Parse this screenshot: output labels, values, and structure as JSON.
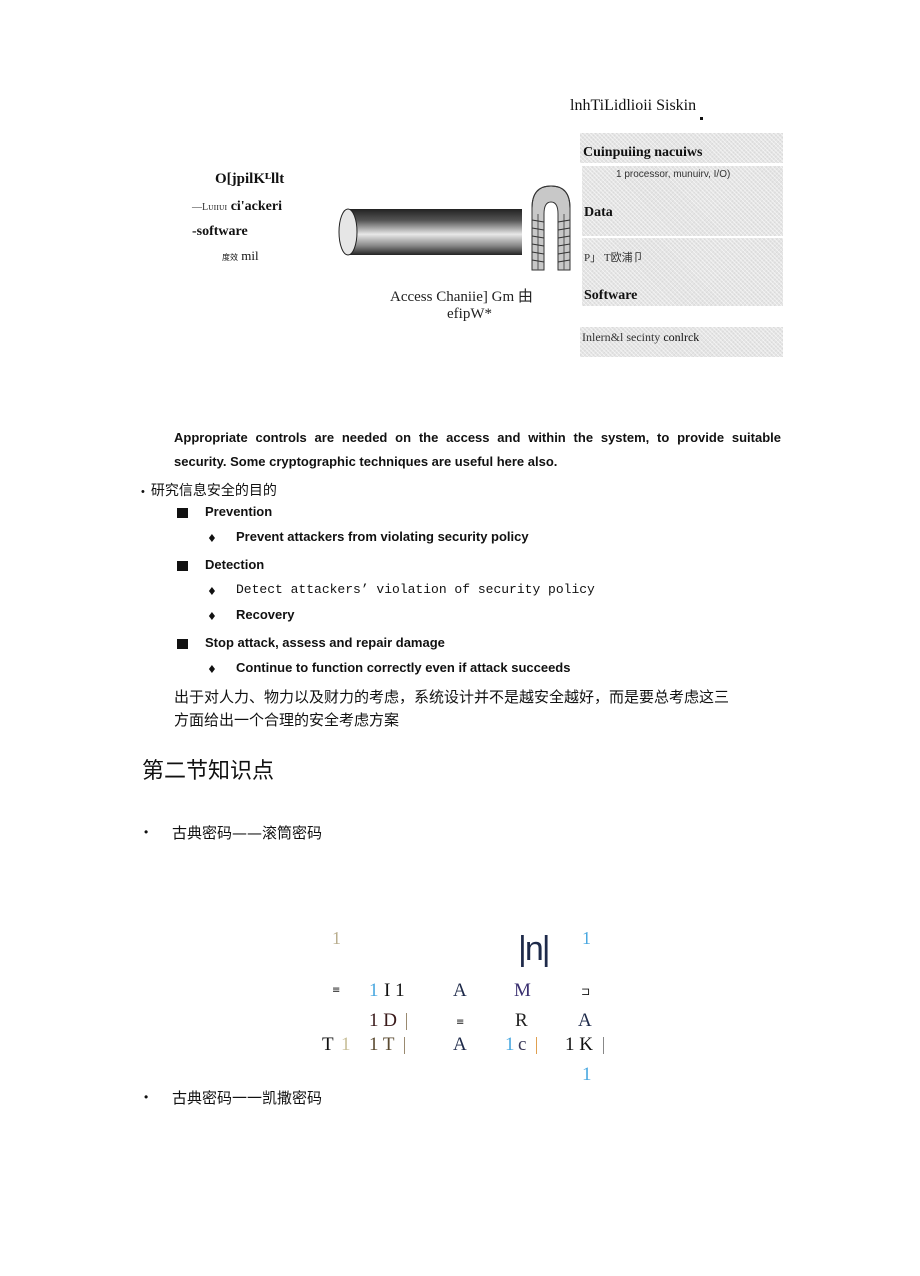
{
  "diagram": {
    "system_title": "lnhTiLidlioii Siskin",
    "outsider_label": {
      "title": "O[jpilKᴸllt",
      "line1_prefix": "—Lᴜɪɪᴜɪ",
      "line1_bold": "ci'ackeri",
      "line2": "-software",
      "line3_cjk": "度效",
      "line3_latin": "mil"
    },
    "channel_label": {
      "line1": "Access Chaniie]  Gm 由",
      "line2": "efipW*"
    },
    "system_panels": [
      {
        "type": "heading",
        "text": "Cuinpuiing nacuiws"
      },
      {
        "type": "note",
        "text": "1 processor, munuirv, I/O)"
      },
      {
        "type": "heading",
        "text": "Data"
      },
      {
        "type": "note",
        "text": "P」 T欧浦卩"
      },
      {
        "type": "heading",
        "text": "Software"
      },
      {
        "type": "footer",
        "text_prefix": "Inlern&l secinty ",
        "text_bold": "conlrck"
      }
    ]
  },
  "paragraph": "Appropriate controls are needed on the access and within the system, to provide suitable security. Some cryptographic techniques are useful here also.",
  "purpose": {
    "bullet": "•",
    "heading": "研究信息安全的目的",
    "items": [
      {
        "label": "Prevention",
        "subs": [
          "Prevent attackers from violating security policy"
        ]
      },
      {
        "label": "Detection",
        "subs": [
          "Detect attackers’  violation of security policy",
          "Recovery"
        ]
      },
      {
        "label": "Stop attack, assess and repair damage",
        "subs": [
          "Continue to function correctly even if attack succeeds"
        ]
      }
    ],
    "sub_bullet": "♦",
    "conclusion_line1": "出于对人力、物力以及财力的考虑，系统设计并不是越安全越好，而是要总考虑这三",
    "conclusion_line2": "方面给出一个合理的安全考虑方案"
  },
  "section": {
    "title": "第二节知识点",
    "topics": [
      {
        "bullet": "•",
        "text": "古典密码——滚筒密码"
      },
      {
        "bullet": "•",
        "text": "古典密码一一凯撒密码"
      }
    ]
  },
  "scytale_fragment": {
    "row0": {
      "a": "1",
      "b": "|n|",
      "c": "1"
    },
    "row1": {
      "a": "≡",
      "b1": "1",
      "b2": "I 1",
      "c": "A",
      "d": "M",
      "e": "⊐"
    },
    "row2": {
      "a": "1 D",
      "b": "≡",
      "c": "R",
      "d": "A"
    },
    "row3": {
      "a": "T",
      "a2": "1",
      "b": "1 T",
      "c": "A",
      "d1": "1",
      "d2": "c",
      "e": "1 K"
    },
    "row4": {
      "a": "1"
    },
    "colors": {
      "tan": "#b9ae8e",
      "blue": "#4aa8e0",
      "navy": "#1e2a4a",
      "purple": "#3a3070",
      "maroon": "#3a1a1a",
      "brown": "#5a4a30",
      "orange": "#e0a050",
      "grey": "#888888"
    }
  }
}
